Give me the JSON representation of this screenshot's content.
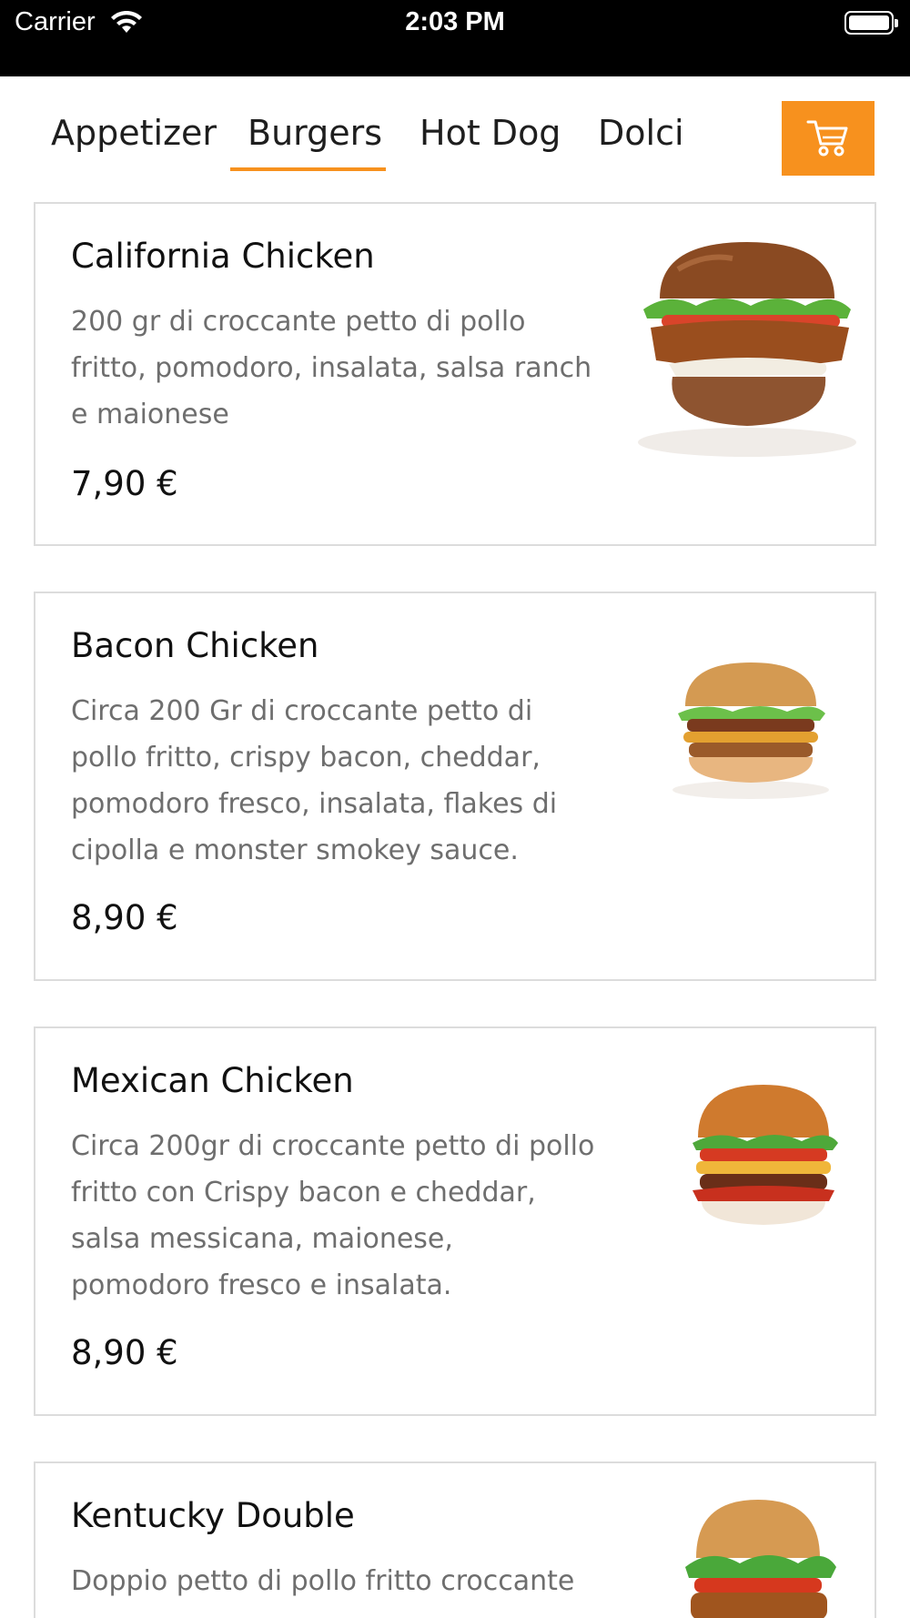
{
  "status_bar": {
    "carrier": "Carrier",
    "time": "2:03 PM"
  },
  "tabs": [
    {
      "label": "Appetizer",
      "selected": false
    },
    {
      "label": "Burgers",
      "selected": true
    },
    {
      "label": "Hot Dog",
      "selected": false
    },
    {
      "label": "Dolci",
      "selected": false
    }
  ],
  "accent_color": "#f7911e",
  "cart": {
    "icon": "cart-icon"
  },
  "products": [
    {
      "name": "California Chicken",
      "description": "200 gr di croccante petto di pollo fritto, pomodoro, insalata, salsa ranch e maionese",
      "price": "7,90 €",
      "image_icon": "burger-image"
    },
    {
      "name": "Bacon Chicken",
      "description": "Circa 200 Gr di croccante petto di pollo fritto, crispy bacon, cheddar, pomodoro fresco, insalata, flakes di cipolla e monster smokey sauce.",
      "price": "8,90 €",
      "image_icon": "burger-image"
    },
    {
      "name": "Mexican Chicken",
      "description": "Circa 200gr di croccante petto di pollo fritto con Crispy bacon e cheddar, salsa messicana, maionese, pomodoro fresco e insalata.",
      "price": "8,90 €",
      "image_icon": "burger-image"
    },
    {
      "name": "Kentucky Double",
      "description": "Doppio petto di pollo fritto croccante",
      "price": "",
      "image_icon": "burger-image"
    }
  ]
}
